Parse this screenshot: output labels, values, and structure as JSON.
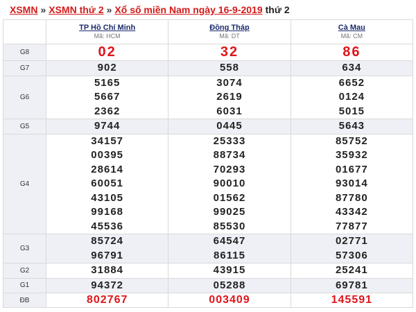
{
  "breadcrumb": {
    "link1": "XSMN",
    "link2": "XSMN thứ 2",
    "link3": "Xổ số miền Nam ngày 16-9-2019",
    "separator": "»",
    "day": "thứ 2"
  },
  "provinces": [
    {
      "name": "TP Hồ Chí Minh",
      "code": "Mã: HCM"
    },
    {
      "name": "Đồng Tháp",
      "code": "Mã: DT"
    },
    {
      "name": "Cà Mau",
      "code": "Mã: CM"
    }
  ],
  "prizes": {
    "g8": {
      "label": "G8",
      "values": [
        [
          "02"
        ],
        [
          "32"
        ],
        [
          "86"
        ]
      ]
    },
    "g7": {
      "label": "G7",
      "values": [
        [
          "902"
        ],
        [
          "558"
        ],
        [
          "634"
        ]
      ]
    },
    "g6": {
      "label": "G6",
      "values": [
        [
          "5165",
          "5667",
          "2362"
        ],
        [
          "3074",
          "2619",
          "6031"
        ],
        [
          "6652",
          "0124",
          "5015"
        ]
      ]
    },
    "g5": {
      "label": "G5",
      "values": [
        [
          "9744"
        ],
        [
          "0445"
        ],
        [
          "5643"
        ]
      ]
    },
    "g4": {
      "label": "G4",
      "values": [
        [
          "34157",
          "00395",
          "28614",
          "60051",
          "43105",
          "99168",
          "45536"
        ],
        [
          "25333",
          "88734",
          "70293",
          "90010",
          "01562",
          "99025",
          "85530"
        ],
        [
          "85752",
          "35932",
          "01677",
          "93014",
          "87780",
          "43342",
          "77877"
        ]
      ]
    },
    "g3": {
      "label": "G3",
      "values": [
        [
          "85724",
          "96791"
        ],
        [
          "64547",
          "86115"
        ],
        [
          "02771",
          "57306"
        ]
      ]
    },
    "g2": {
      "label": "G2",
      "values": [
        [
          "31884"
        ],
        [
          "43915"
        ],
        [
          "25241"
        ]
      ]
    },
    "g1": {
      "label": "G1",
      "values": [
        [
          "94372"
        ],
        [
          "05288"
        ],
        [
          "69781"
        ]
      ]
    },
    "db": {
      "label": "ĐB",
      "values": [
        [
          "802767"
        ],
        [
          "003409"
        ],
        [
          "145591"
        ]
      ]
    }
  },
  "colors": {
    "prize_red": "#e0141a",
    "link_red": "#d21a1a",
    "header_link": "#1a2a6c",
    "label_bg": "#eef0f6"
  }
}
